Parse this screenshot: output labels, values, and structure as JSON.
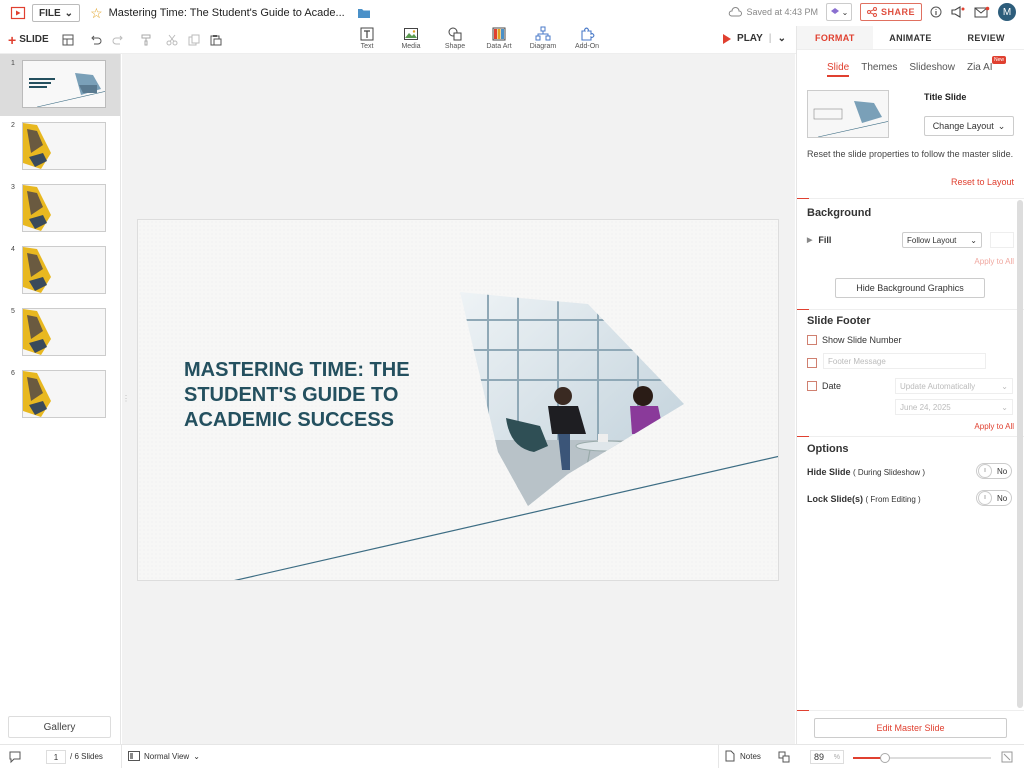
{
  "app": {
    "file_label": "FILE",
    "doc_title": "Mastering Time: The Student's Guide to Acade...",
    "saved_text": "Saved at 4:43 PM",
    "share_label": "SHARE",
    "avatar_initial": "M"
  },
  "toolbar": {
    "add_slide_label": "SLIDE",
    "insert_items": [
      {
        "label": "Text"
      },
      {
        "label": "Media"
      },
      {
        "label": "Shape"
      },
      {
        "label": "Data Art"
      },
      {
        "label": "Diagram"
      },
      {
        "label": "Add-On"
      }
    ],
    "play_label": "PLAY"
  },
  "slides_panel": {
    "slide_numbers": [
      "1",
      "2",
      "3",
      "4",
      "5",
      "6"
    ],
    "active_slide": 1,
    "gallery_label": "Gallery"
  },
  "slide": {
    "title": "MASTERING TIME: THE STUDENT'S GUIDE TO ACADEMIC SUCCESS"
  },
  "right_panel": {
    "main_tabs": [
      "FORMAT",
      "ANIMATE",
      "REVIEW"
    ],
    "sub_tabs": [
      "Slide",
      "Themes",
      "Slideshow",
      "Zia AI"
    ],
    "new_badge": "New",
    "layout_name": "Title Slide",
    "change_layout_label": "Change Layout",
    "reset_description": "Reset the slide properties to follow the master slide.",
    "reset_link": "Reset to Layout",
    "background": {
      "title": "Background",
      "fill_label": "Fill",
      "fill_value": "Follow Layout",
      "apply_all": "Apply to All",
      "hide_graphics_label": "Hide Background Graphics"
    },
    "footer": {
      "title": "Slide Footer",
      "show_slide_number": "Show Slide Number",
      "footer_placeholder": "Footer Message",
      "date_label": "Date",
      "date_mode": "Update Automatically",
      "date_value": "June 24, 2025",
      "apply_all": "Apply to All"
    },
    "options": {
      "title": "Options",
      "hide_slide_label": "Hide Slide",
      "hide_slide_sub": "( During Slideshow )",
      "lock_slide_label": "Lock Slide(s)",
      "lock_slide_sub": "( From Editing )",
      "toggle_off_label": "No"
    },
    "edit_master_label": "Edit Master Slide"
  },
  "statusbar": {
    "current_page": "1",
    "total_slides": "/ 6 Slides",
    "view_label": "Normal View",
    "notes_label": "Notes",
    "zoom_value": "89",
    "zoom_unit": "%",
    "zoom_fraction": 0.23
  },
  "colors": {
    "accent": "#e04030",
    "title_text": "#24505f",
    "diagonal_line": "#3d6d84"
  }
}
